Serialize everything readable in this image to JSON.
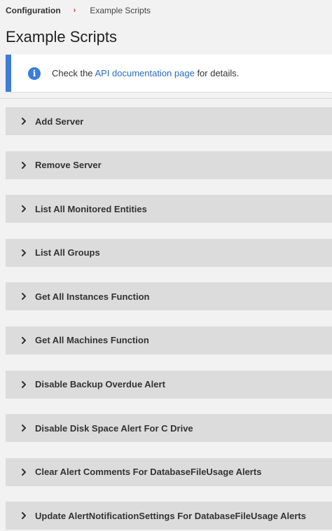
{
  "breadcrumb": {
    "root": "Configuration",
    "separator": "›",
    "current": "Example Scripts"
  },
  "page_title": "Example Scripts",
  "info": {
    "icon": "info-icon",
    "prefix": "Check the ",
    "link_text": "API documentation page",
    "suffix": " for details."
  },
  "scripts": [
    {
      "label": "Add Server"
    },
    {
      "label": "Remove Server"
    },
    {
      "label": "List All Monitored Entities"
    },
    {
      "label": "List All Groups"
    },
    {
      "label": "Get All Instances Function"
    },
    {
      "label": "Get All Machines Function"
    },
    {
      "label": "Disable Backup Overdue Alert"
    },
    {
      "label": "Disable Disk Space Alert For C Drive"
    },
    {
      "label": "Clear Alert Comments For DatabaseFileUsage Alerts"
    },
    {
      "label": "Update AlertNotificationSettings For DatabaseFileUsage Alerts"
    }
  ],
  "colors": {
    "accent": "#3b7dd8",
    "link": "#2a6bc7",
    "separator": "#c0392b",
    "panel": "#dcdcdc",
    "background": "#f2f2f2"
  }
}
